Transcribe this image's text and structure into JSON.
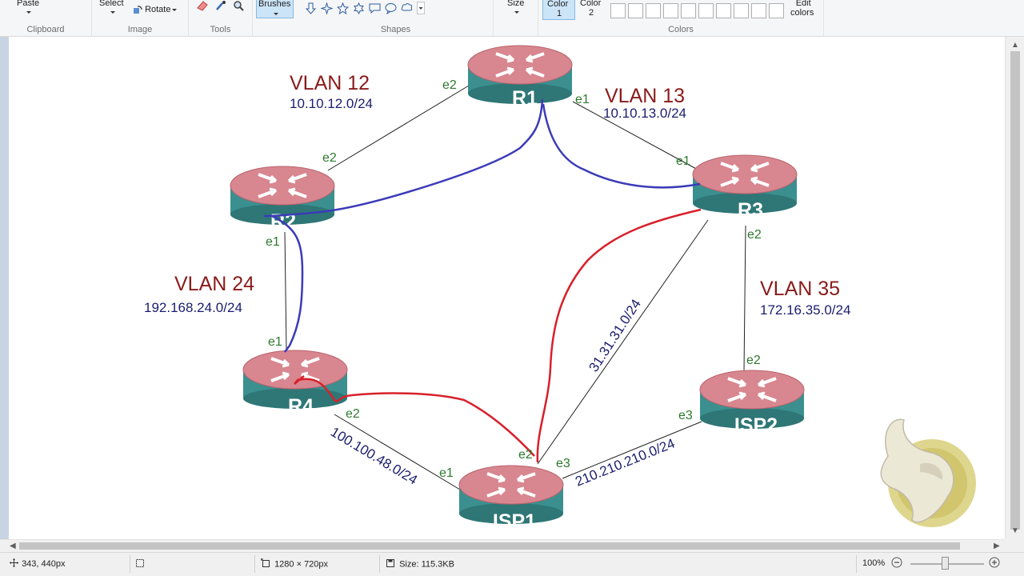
{
  "ribbon": {
    "clipboard": {
      "paste_label": "Paste",
      "group_label": "Clipboard"
    },
    "image": {
      "select_label": "Select",
      "rotate_label": "Rotate",
      "group_label": "Image"
    },
    "tools": {
      "group_label": "Tools"
    },
    "brushes": {
      "label": "Brushes"
    },
    "shapes": {
      "group_label": "Shapes"
    },
    "size": {
      "label": "Size"
    },
    "colors": {
      "color1_label": "Color",
      "color1_num": "1",
      "color2_label": "Color",
      "color2_num": "2",
      "edit_label": "Edit",
      "edit_label2": "colors",
      "group_label": "Colors"
    }
  },
  "diagram": {
    "routers": [
      "R1",
      "R2",
      "R3",
      "R4",
      "ISP1",
      "ISP2"
    ],
    "vlans": [
      {
        "name": "VLAN 12",
        "subnet": "10.10.12.0/24"
      },
      {
        "name": "VLAN 13",
        "subnet": "10.10.13.0/24"
      },
      {
        "name": "VLAN 24",
        "subnet": "192.168.24.0/24"
      },
      {
        "name": "VLAN 35",
        "subnet": "172.16.35.0/24"
      }
    ],
    "links": {
      "r3_isp1": "31.31.31.0/24",
      "r4_isp1": "100.100.48.0/24",
      "isp1_isp2": "210.210.210.0/24"
    },
    "interfaces": {
      "r1_e2": "e2",
      "r1_e1": "e1",
      "r2_e2": "e2",
      "r2_e1": "e1",
      "r3_e1": "e1",
      "r3_e2": "e2",
      "r4_e1": "e1",
      "r4_e2": "e2",
      "isp1_e1": "e1",
      "isp1_e2": "e2",
      "isp1_e3": "e3",
      "isp2_e2": "e2",
      "isp2_e3": "e3"
    },
    "colors": {
      "blue_path": "#3b3bb8",
      "red_path": "#d8202a",
      "router_top": "#d98b93",
      "router_side": "#3a8e8e"
    }
  },
  "status": {
    "cursor_pos": "343, 440px",
    "dimensions": "1280 × 720px",
    "file_size": "Size: 115.3KB",
    "zoom": "100%"
  }
}
